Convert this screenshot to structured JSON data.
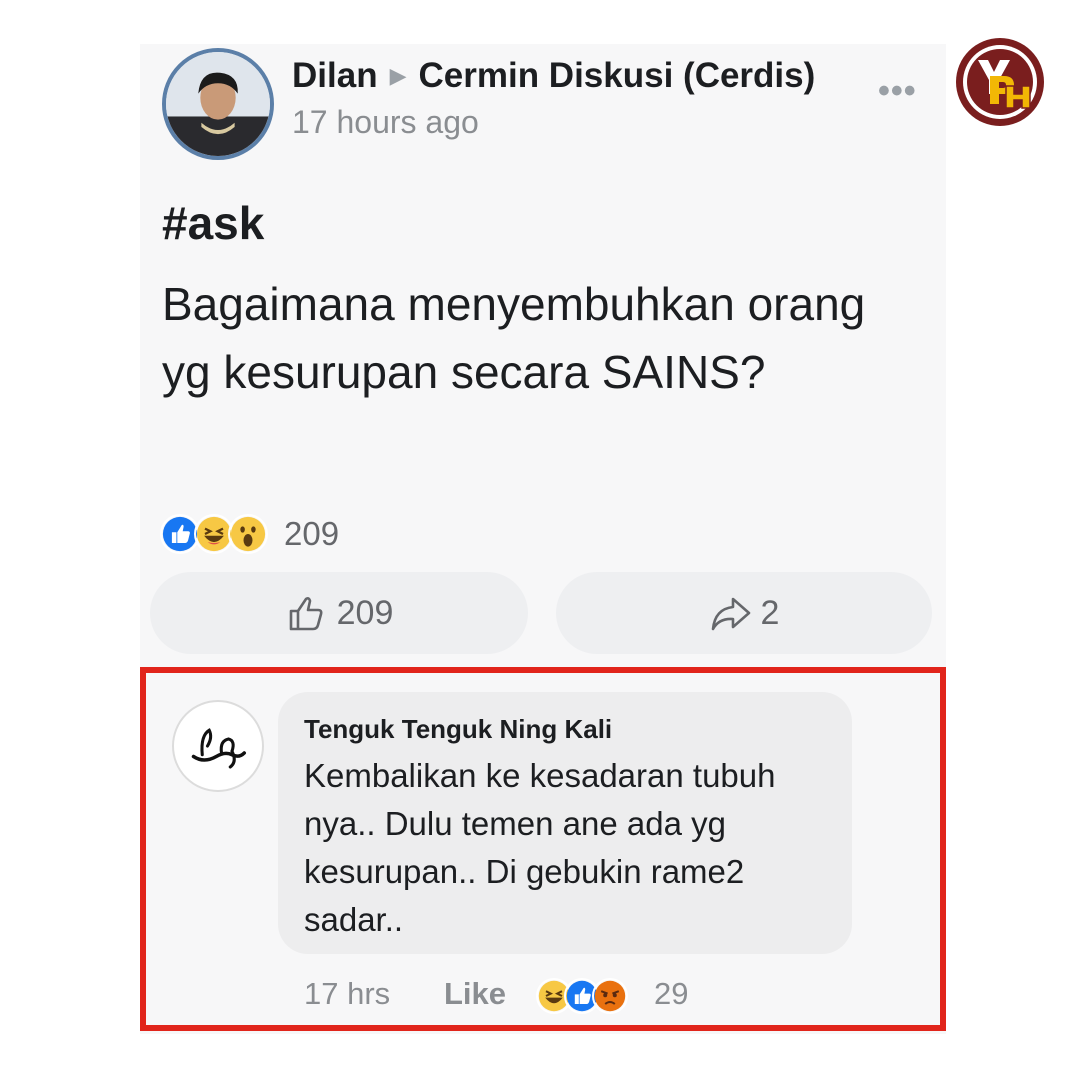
{
  "post": {
    "author": "Dilan",
    "group": "Cermin Diskusi (Cerdis)",
    "timestamp": "17 hours ago",
    "more_label": "•••",
    "hashtag": "#ask",
    "body": "Bagaimana menyembuhkan orang yg kesurupan secara SAINS?",
    "reactions": [
      "like",
      "haha",
      "wow"
    ],
    "reaction_count": "209",
    "like_count": "209",
    "share_count": "2"
  },
  "comment": {
    "author": "Tenguk Tenguk Ning Kali",
    "text": "Kembalikan ke kesadaran tubuh nya.. Dulu temen ane ada yg kesurupan.. Di gebukin rame2 sadar..",
    "time": "17 hrs",
    "like_label": "Like",
    "reactions": [
      "haha",
      "like",
      "angry"
    ],
    "reaction_count": "29"
  },
  "colors": {
    "highlight_border": "#e1251b",
    "like_blue": "#1877f2",
    "reaction_yellow": "#f7c844",
    "angry_orange": "#e9710f",
    "logo_maroon": "#7a1e1e",
    "logo_yellow": "#f2b705"
  },
  "icons": {
    "thumb": "thumbs-up-outline-icon",
    "share": "share-arrow-icon",
    "separator": "triangle-right-icon",
    "watermark": "yph-logo"
  }
}
